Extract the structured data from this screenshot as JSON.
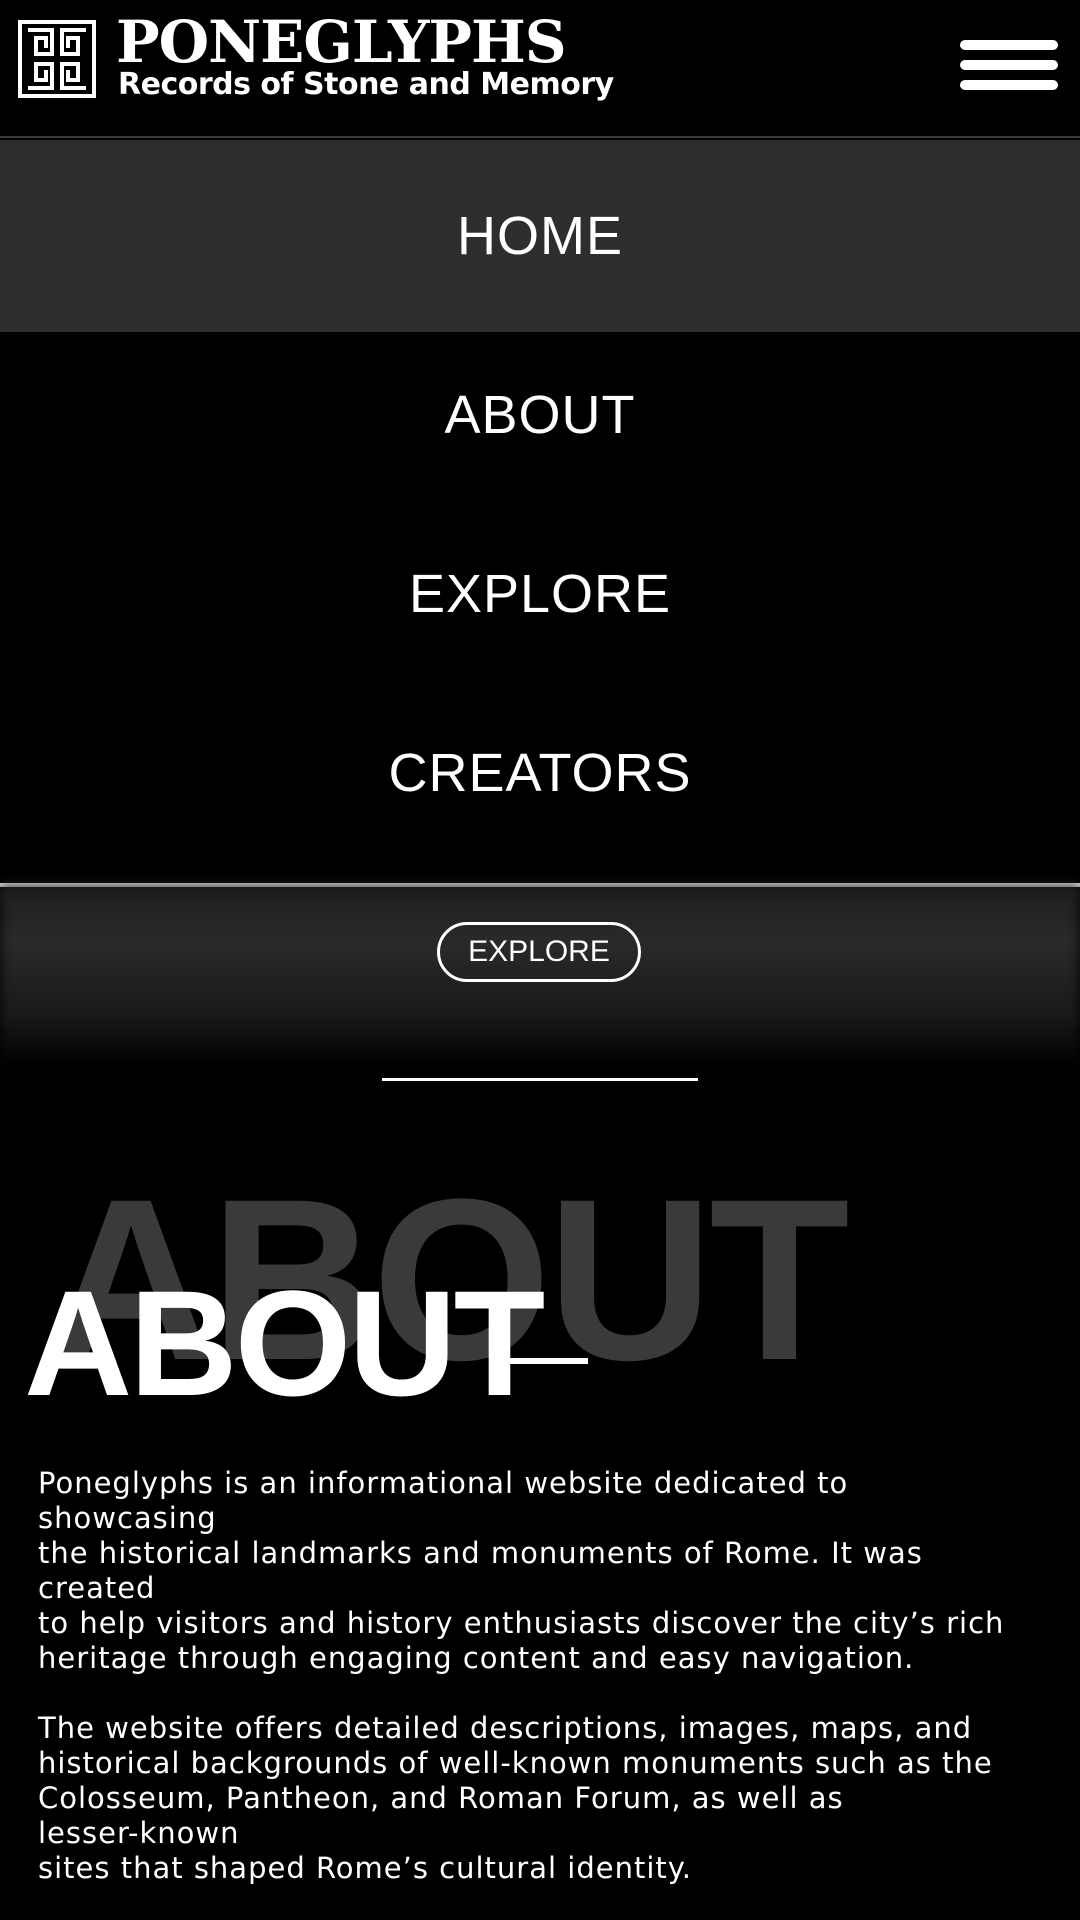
{
  "header": {
    "title": "PONEGLYPHS",
    "subtitle": "Records of Stone and Memory",
    "logo_icon": "greek-key-icon",
    "menu_icon": "hamburger-menu-icon"
  },
  "nav": {
    "items": [
      {
        "label": "HOME",
        "active": true
      },
      {
        "label": "ABOUT",
        "active": false
      },
      {
        "label": "EXPLORE",
        "active": false
      },
      {
        "label": "CREATORS",
        "active": false
      }
    ]
  },
  "hero": {
    "explore_label": "EXPLORE"
  },
  "about": {
    "bg_title": "ABOUT",
    "title": "ABOUT",
    "paragraph1": [
      "Poneglyphs is an informational website dedicated to",
      "showcasing",
      "the historical landmarks and monuments of Rome. It was",
      "created",
      "to help visitors and history enthusiasts discover the city’s rich",
      "heritage through engaging content and easy navigation."
    ],
    "paragraph2": [
      "The website offers detailed descriptions, images, maps, and",
      "historical backgrounds of well-known monuments such as the",
      "Colosseum, Pantheon, and Roman Forum, as well as",
      "lesser-known",
      "sites that shaped Rome’s cultural identity."
    ]
  },
  "colors": {
    "background": "#000000",
    "active_nav": "#2e2e2e",
    "ghost_title": "#3a3a3a",
    "text": "#ffffff"
  }
}
